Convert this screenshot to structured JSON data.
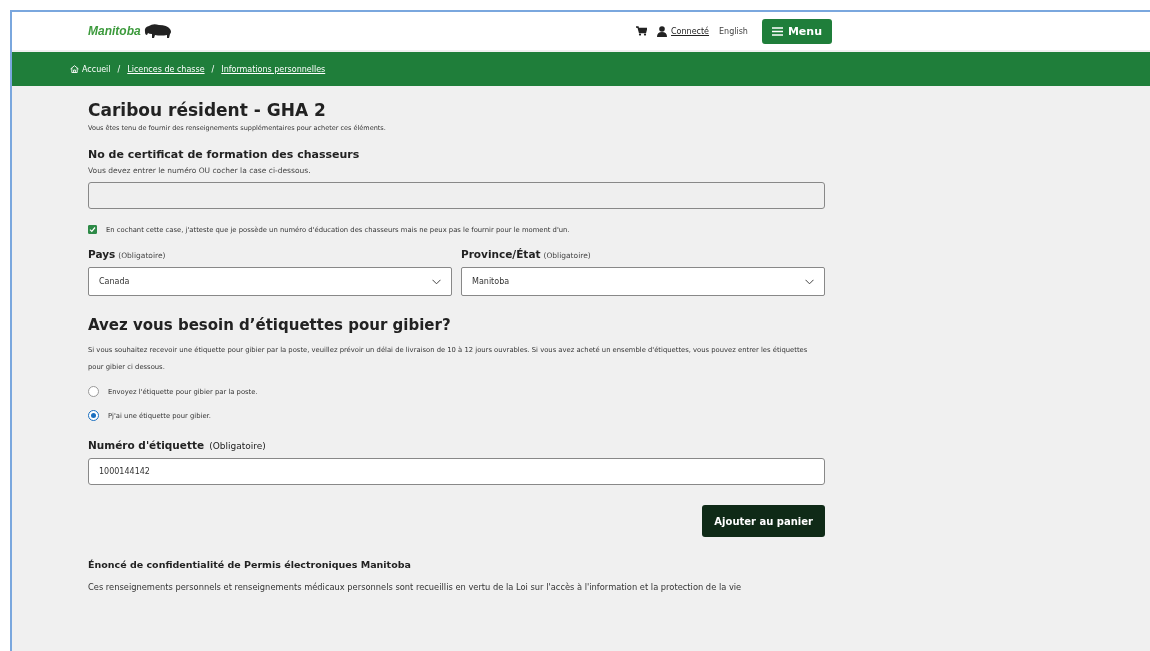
{
  "header": {
    "logo": "Manitoba",
    "account": "Connecté",
    "language": "English",
    "menu": "Menu"
  },
  "breadcrumbs": {
    "separator": "/",
    "items": [
      {
        "label": "Accueil",
        "kind": "home"
      },
      {
        "label": "Licences de chasse",
        "kind": "link"
      },
      {
        "label": "Informations personnelles",
        "kind": "link"
      }
    ]
  },
  "form": {
    "title": "Caribou résident - GHA 2",
    "subtitle": "Vous êtes tenu de fournir des renseignements supplémentaires pour acheter ces éléments.",
    "certificate": {
      "label": "No de certificat de formation des chasseurs",
      "hint": "Vous devez entrer le numéro OU cocher la case ci-dessous."
    },
    "checkbox": {
      "label": "En cochant cette case, j'atteste que je possède un numéro d'éducation des chasseurs mais ne peux pas le fournir pour le moment d'un.",
      "checked": true
    },
    "selects": [
      {
        "label": "Pays",
        "required": "(Obligatoire)",
        "value": "Canada"
      },
      {
        "label": "Province/État",
        "required": "(Obligatoire)",
        "value": "Manitoba"
      }
    ],
    "tags": {
      "heading": "Avez vous besoin d’étiquettes pour gibier?",
      "description": "Si vous souhaitez recevoir une étiquette pour gibier par la poste, veuillez prévoir un délai de livraison de 10 à 12 jours ouvrables. Si vous avez acheté un ensemble d'étiquettes, vous pouvez entrer les étiquettes pour gibier ci dessous.",
      "options": [
        {
          "label": "Envoyez l'étiquette pour gibier par la poste.",
          "selected": false
        },
        {
          "label": "Pj'ai une étiquette pour gibier.",
          "selected": true
        }
      ]
    },
    "tag_number": {
      "label": "Numéro d'étiquette",
      "required": "(Obligatoire)",
      "value": "1000144142"
    },
    "submit": "Ajouter au panier",
    "privacy": {
      "heading": "Énoncé de confidentialité de Permis électroniques Manitoba",
      "text": "Ces renseignements personnels et renseignements médicaux personnels sont recueillis en vertu de la Loi sur l'accès à l'information et la protection de la vie"
    }
  }
}
